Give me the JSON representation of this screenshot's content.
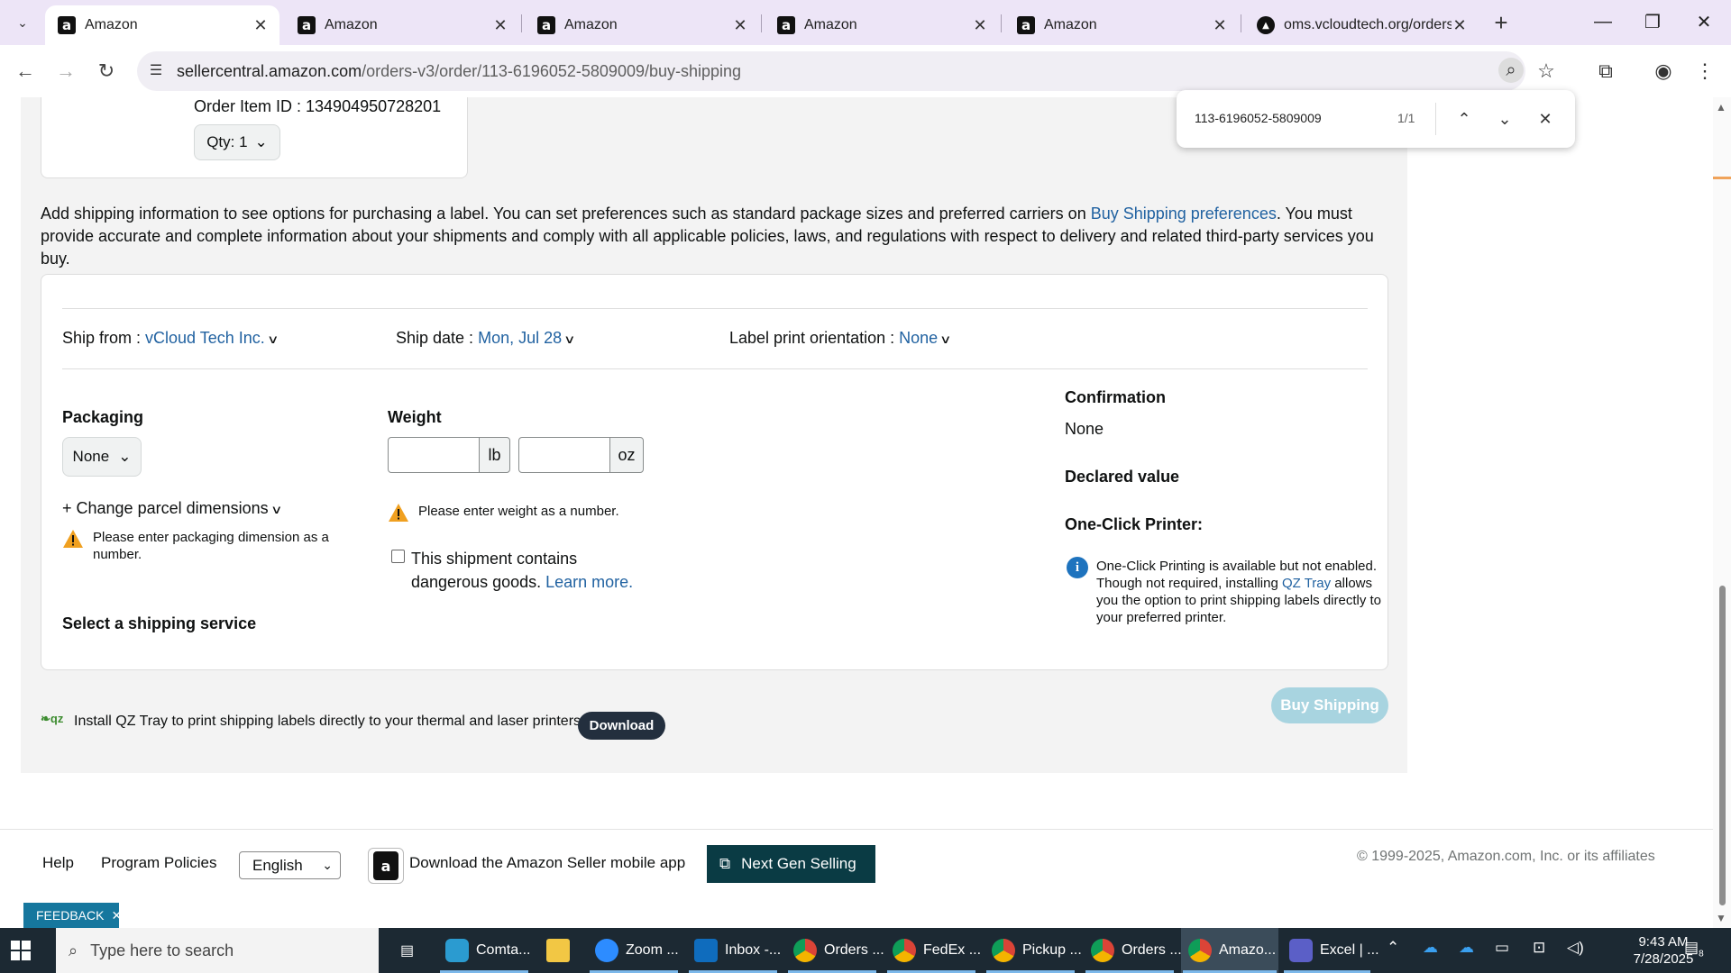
{
  "browser": {
    "tabs": [
      {
        "title": "Amazon",
        "favicon": "amazon-icon",
        "active": true
      },
      {
        "title": "Amazon",
        "favicon": "amazon-icon",
        "active": false
      },
      {
        "title": "Amazon",
        "favicon": "amazon-icon",
        "active": false
      },
      {
        "title": "Amazon",
        "favicon": "amazon-icon",
        "active": false
      },
      {
        "title": "Amazon",
        "favicon": "amazon-icon",
        "active": false
      },
      {
        "title": "oms.vcloudtech.org/orders",
        "favicon": "oms-icon",
        "active": false
      }
    ],
    "url_host": "sellercentral.amazon.com",
    "url_path": "/orders-v3/order/113-6196052-5809009/buy-shipping"
  },
  "find_bar": {
    "query": "113-6196052-5809009",
    "count": "1/1"
  },
  "order_item": {
    "id_text": "Order Item ID : 134904950728201",
    "qty_label": "Qty: 1"
  },
  "intro": {
    "text_before": "Add shipping information to see options for purchasing a label. You can set preferences such as standard package sizes and preferred carriers on ",
    "link": "Buy Shipping preferences",
    "text_after": ". You must provide accurate and complete information about your shipments and comply with all applicable policies, laws, and regulations with respect to delivery and related third-party services you buy."
  },
  "ship_row": {
    "ship_from_label": "Ship from : ",
    "ship_from_value": "vCloud Tech Inc.",
    "ship_date_label": "Ship date : ",
    "ship_date_value": "Mon, Jul 28",
    "orientation_label": "Label print orientation : ",
    "orientation_value": "None"
  },
  "packaging": {
    "title": "Packaging",
    "selected": "None",
    "change_dims_link": "+ Change parcel dimensions",
    "warning": "Please enter packaging dimension as a number."
  },
  "weight": {
    "title": "Weight",
    "lb_value": "",
    "oz_value": "",
    "lb_unit": "lb",
    "oz_unit": "oz",
    "warning": "Please enter weight as a number.",
    "dangerous_text": "This shipment contains dangerous goods. ",
    "learn_more": "Learn more."
  },
  "right_col": {
    "confirmation_title": "Confirmation",
    "confirmation_value": "None",
    "declared_title": "Declared value",
    "printer_title": "One-Click Printer:",
    "printer_note_before": "One-Click Printing is available but not enabled. Though not required, installing ",
    "printer_note_link": "QZ Tray",
    "printer_note_after": " allows you the option to print shipping labels directly to your preferred printer."
  },
  "select_service_title": "Select a shipping service",
  "qz": {
    "logo": "qz",
    "text": "Install QZ Tray to print shipping labels directly to your thermal and laser printers.",
    "download": "Download"
  },
  "buy_shipping": "Buy Shipping",
  "footer": {
    "help": "Help",
    "policies": "Program Policies",
    "language": "English",
    "app_text": "Download the Amazon Seller mobile app",
    "next_gen": "Next Gen Selling",
    "copyright": "© 1999-2025, Amazon.com, Inc. or its affiliates",
    "feedback": "FEEDBACK"
  },
  "taskbar": {
    "search_placeholder": "Type here to search",
    "items": [
      {
        "label": "Comta...",
        "icon": "app-icon"
      },
      {
        "label": "",
        "icon": "file-explorer-icon"
      },
      {
        "label": "Zoom ...",
        "icon": "zoom-icon"
      },
      {
        "label": "Inbox -...",
        "icon": "outlook-icon"
      },
      {
        "label": "Orders ...",
        "icon": "chrome-icon"
      },
      {
        "label": "FedEx ...",
        "icon": "chrome-icon"
      },
      {
        "label": "Pickup ...",
        "icon": "chrome-icon"
      },
      {
        "label": "Orders ...",
        "icon": "chrome-icon"
      },
      {
        "label": "Amazo...",
        "icon": "chrome-icon"
      },
      {
        "label": "Excel | ...",
        "icon": "teams-icon"
      }
    ],
    "time": "9:43 AM",
    "date": "7/28/2025",
    "notifications": "8"
  },
  "colors": {
    "link": "#2162a1",
    "buy_button_disabled": "#a8d4e0",
    "next_gen": "#0a3b44",
    "feedback": "#16779e",
    "warning": "#f0a020",
    "info": "#1e73be"
  }
}
